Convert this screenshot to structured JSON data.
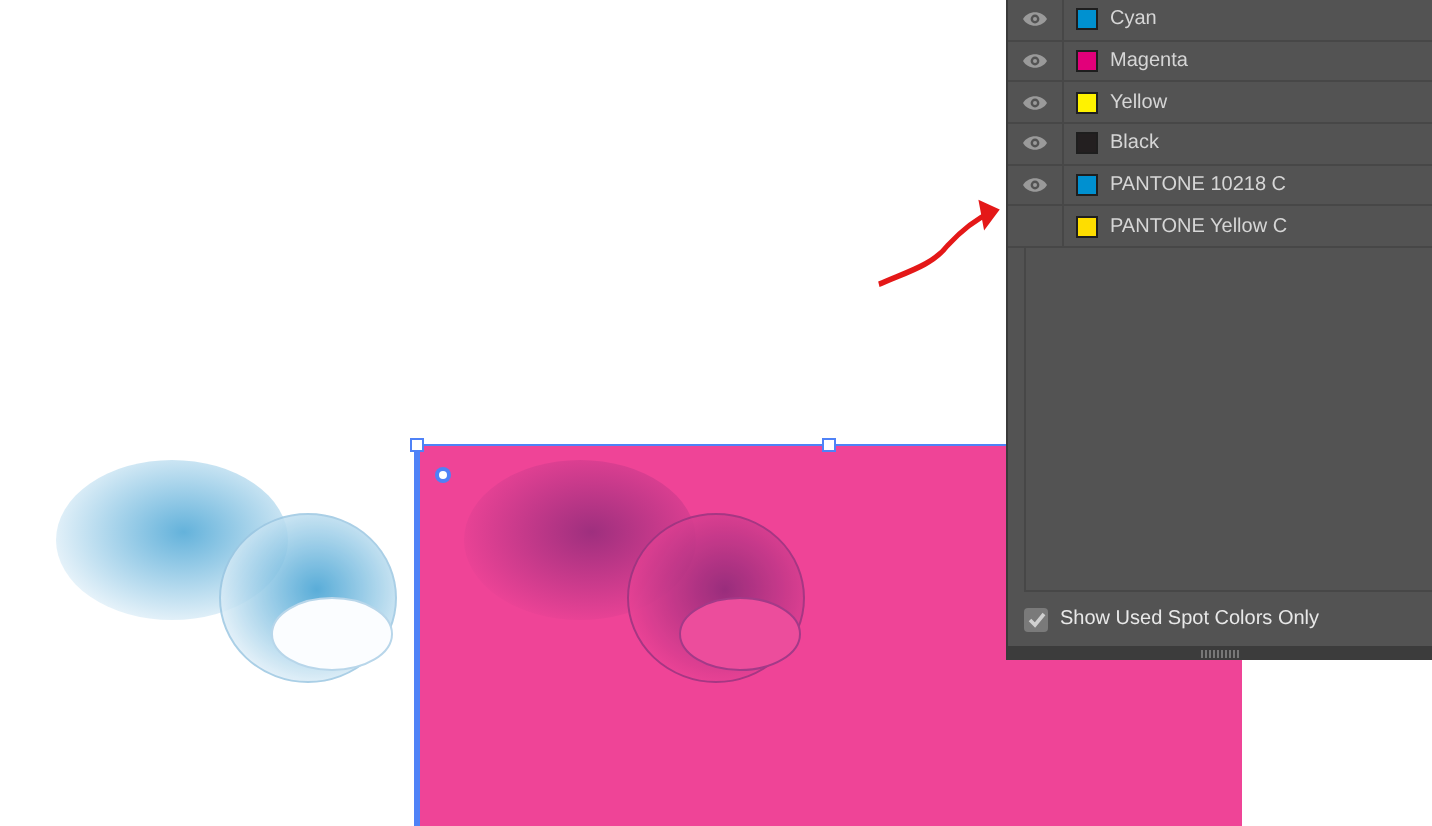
{
  "separations_panel": {
    "rows": [
      {
        "name": "Cyan",
        "visible": true,
        "color": "#0091d0"
      },
      {
        "name": "Magenta",
        "visible": true,
        "color": "#e2007a"
      },
      {
        "name": "Yellow",
        "visible": true,
        "color": "#fff200"
      },
      {
        "name": "Black",
        "visible": true,
        "color": "#231f20"
      },
      {
        "name": "PANTONE 10218 C",
        "visible": true,
        "color": "#0090d0"
      },
      {
        "name": "PANTONE Yellow C",
        "visible": false,
        "color": "#fedd00"
      }
    ],
    "show_used_spot_colors_only": {
      "label": "Show Used Spot Colors Only",
      "checked": true
    }
  }
}
